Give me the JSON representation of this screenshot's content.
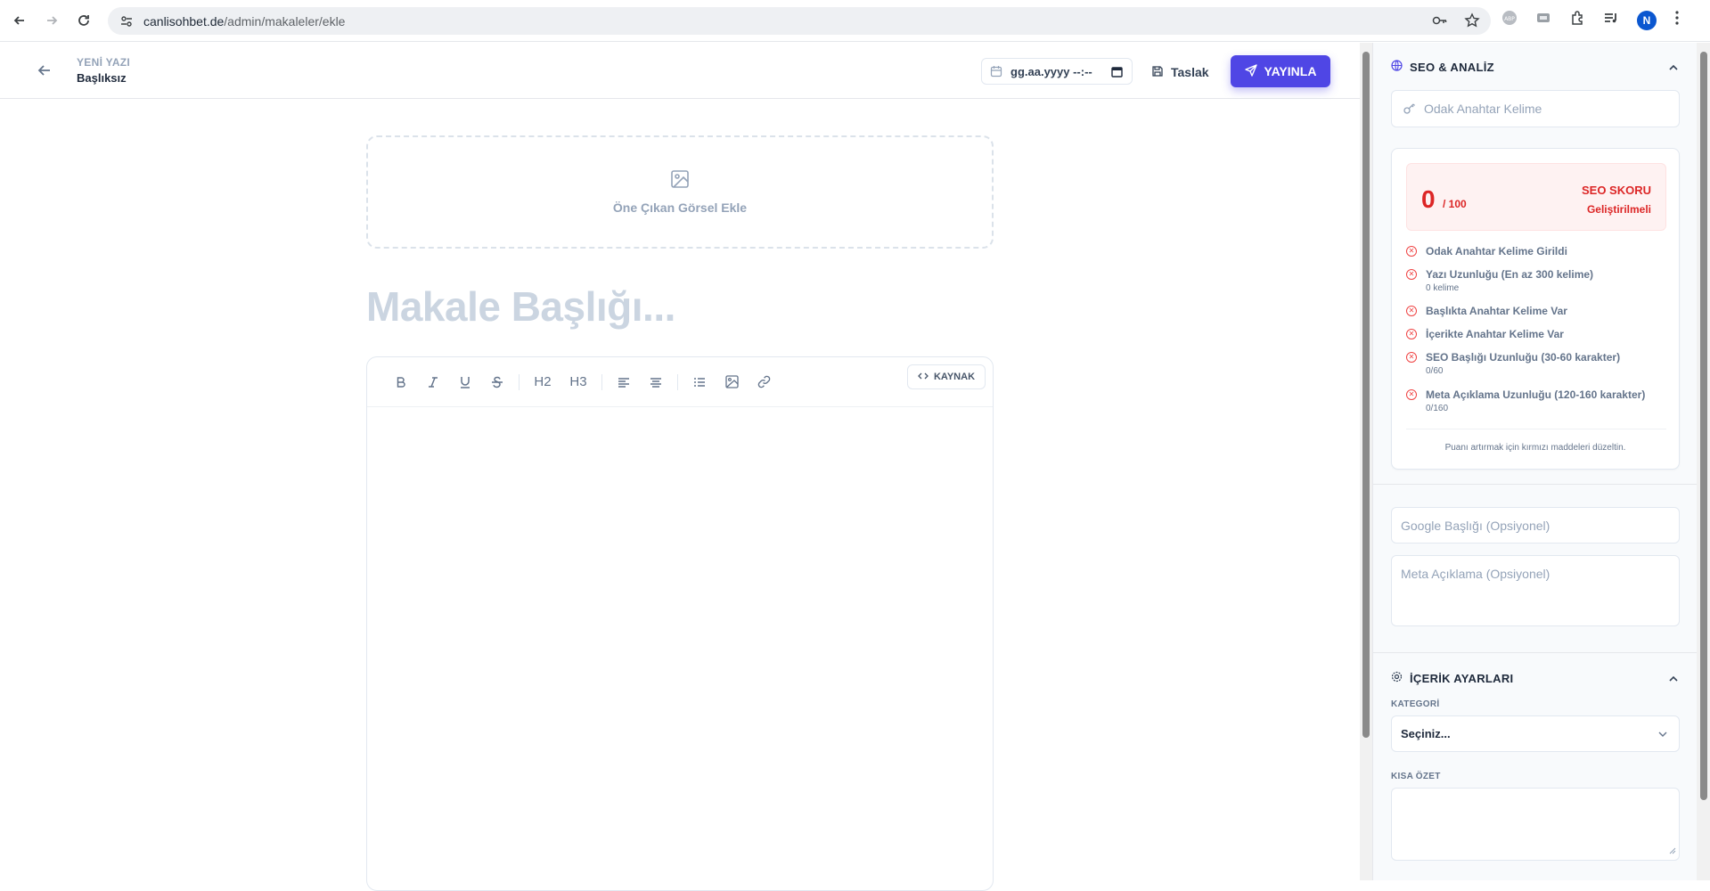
{
  "browser": {
    "url_host": "canlisohbet.de",
    "url_path": "/admin/makaleler/ekle",
    "profile_initial": "N"
  },
  "header": {
    "kicker": "YENİ YAZI",
    "doc_name": "Başlıksız",
    "date_placeholder": "gg.aa.yyyy --:--",
    "draft_label": "Taslak",
    "publish_label": "YAYINLA"
  },
  "editor": {
    "featured_image_label": "Öne Çıkan Görsel Ekle",
    "title_placeholder": "Makale Başlığı...",
    "toolbar": {
      "h2": "H2",
      "h3": "H3",
      "source_label": "KAYNAK"
    }
  },
  "seo": {
    "section_title": "SEO & ANALİZ",
    "keyword_placeholder": "Odak Anahtar Kelime",
    "score": "0",
    "score_max": "/ 100",
    "score_title": "SEO SKORU",
    "score_status": "Geliştirilmeli",
    "checks": [
      {
        "label": "Odak Anahtar Kelime Girildi",
        "sub": ""
      },
      {
        "label": "Yazı Uzunluğu (En az 300 kelime)",
        "sub": "0 kelime"
      },
      {
        "label": "Başlıkta Anahtar Kelime Var",
        "sub": ""
      },
      {
        "label": "İçerikte Anahtar Kelime Var",
        "sub": ""
      },
      {
        "label": "SEO Başlığı Uzunluğu (30-60 karakter)",
        "sub": "0/60"
      },
      {
        "label": "Meta Açıklama Uzunluğu (120-160 karakter)",
        "sub": "0/160"
      }
    ],
    "hint": "Puanı artırmak için kırmızı maddeleri düzeltin.",
    "google_title_placeholder": "Google Başlığı (Opsiyonel)",
    "meta_desc_placeholder": "Meta Açıklama (Opsiyonel)"
  },
  "content_settings": {
    "section_title": "İÇERİK AYARLARI",
    "category_label": "KATEGORİ",
    "category_value": "Seçiniz...",
    "summary_label": "KISA ÖZET"
  },
  "colors": {
    "accent": "#4f46e5",
    "danger": "#dc2626"
  }
}
